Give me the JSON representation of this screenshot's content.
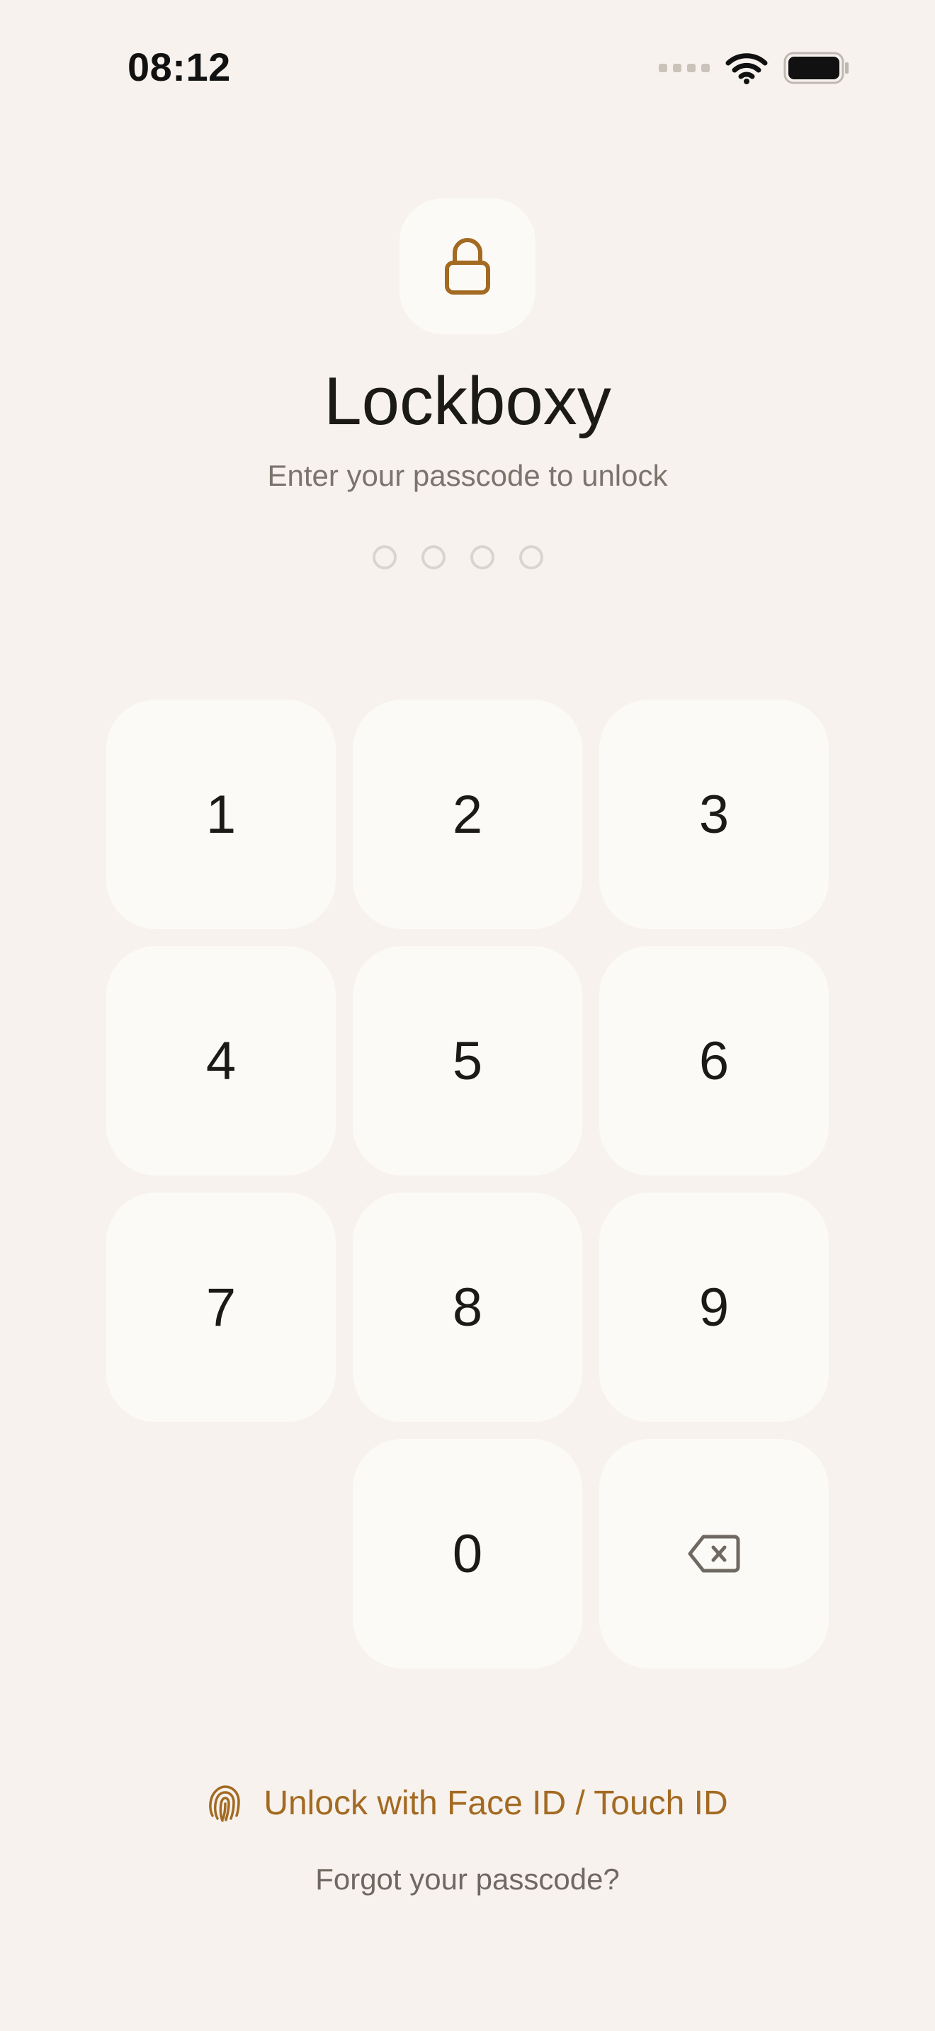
{
  "status_bar": {
    "time": "08:12"
  },
  "app": {
    "title": "Lockboxy",
    "subtitle": "Enter your passcode to unlock",
    "accent_color": "#A36A22",
    "lock_icon": "lock-icon"
  },
  "passcode": {
    "length": 4,
    "entered": 0
  },
  "keypad": {
    "keys": [
      "1",
      "2",
      "3",
      "4",
      "5",
      "6",
      "7",
      "8",
      "9",
      "0"
    ],
    "backspace_icon": "backspace-icon"
  },
  "biometric": {
    "label": "Unlock with Face ID / Touch ID",
    "icon": "fingerprint-icon"
  },
  "forgot_label": "Forgot your passcode?"
}
